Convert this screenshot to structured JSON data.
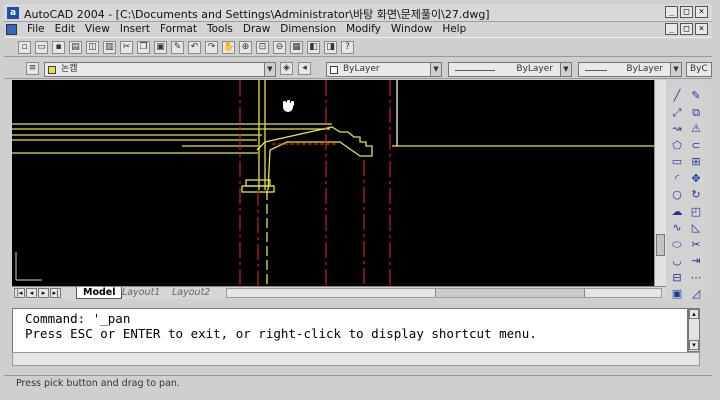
{
  "window": {
    "title": "AutoCAD 2004 - [C:\\Documents and Settings\\Administrator\\바탕 화면\\문제풀이\\27.dwg]",
    "app_icon_glyph": "a",
    "controls": [
      "_",
      "□",
      "×"
    ]
  },
  "menu": {
    "items": [
      "File",
      "Edit",
      "View",
      "Insert",
      "Format",
      "Tools",
      "Draw",
      "Dimension",
      "Modify",
      "Window",
      "Help"
    ],
    "controls": [
      "_",
      "□",
      "×"
    ]
  },
  "properties": {
    "layer_name": "논캠",
    "color": "ByLayer",
    "linetype": "ByLayer",
    "lineweight": "ByLayer",
    "plotstyle": "ByC"
  },
  "drawing": {
    "background": "#000000",
    "colors": {
      "construction": "#e4e44a",
      "centerline": "#cc2222",
      "frame": "#ffffff",
      "ucs": "#cfcfcf"
    }
  },
  "layout_tabs": [
    "Model",
    "Layout1",
    "Layout2"
  ],
  "nav_glyphs": [
    "|◂",
    "◂",
    "▸",
    "▸|"
  ],
  "command": {
    "line1": "Command: '_pan",
    "line2": "Press ESC or ENTER to exit, or right-click to display shortcut menu."
  },
  "status": {
    "text": "Press pick button and drag to pan."
  },
  "icons": {
    "toolbar1": [
      "new-icon",
      "open-icon",
      "save-icon",
      "print-icon",
      "preview-icon",
      "plot-icon",
      "cut-icon",
      "copy-icon",
      "paste-icon",
      "matchprop-icon",
      "undo-icon",
      "redo-icon",
      "pan-icon",
      "zoom-realtime-icon",
      "zoom-window-icon",
      "zoom-previous-icon",
      "properties-icon",
      "design-center-icon",
      "tool-palettes-icon",
      "help-icon"
    ],
    "draw_modify": [
      "line-icon",
      "erase-icon",
      "xline-icon",
      "copy-icon",
      "pline-icon",
      "mirror-icon",
      "polygon-icon",
      "offset-icon",
      "rectangle-icon",
      "array-icon",
      "arc-icon",
      "move-icon",
      "circle-icon",
      "rotate-icon",
      "revcloud-icon",
      "scale-icon",
      "spline-icon",
      "stretch-icon",
      "ellipse-icon",
      "trim-icon",
      "ellipse-arc-icon",
      "extend-icon",
      "insert-block-icon",
      "break-icon",
      "make-block-icon",
      "chamfer-icon"
    ]
  }
}
